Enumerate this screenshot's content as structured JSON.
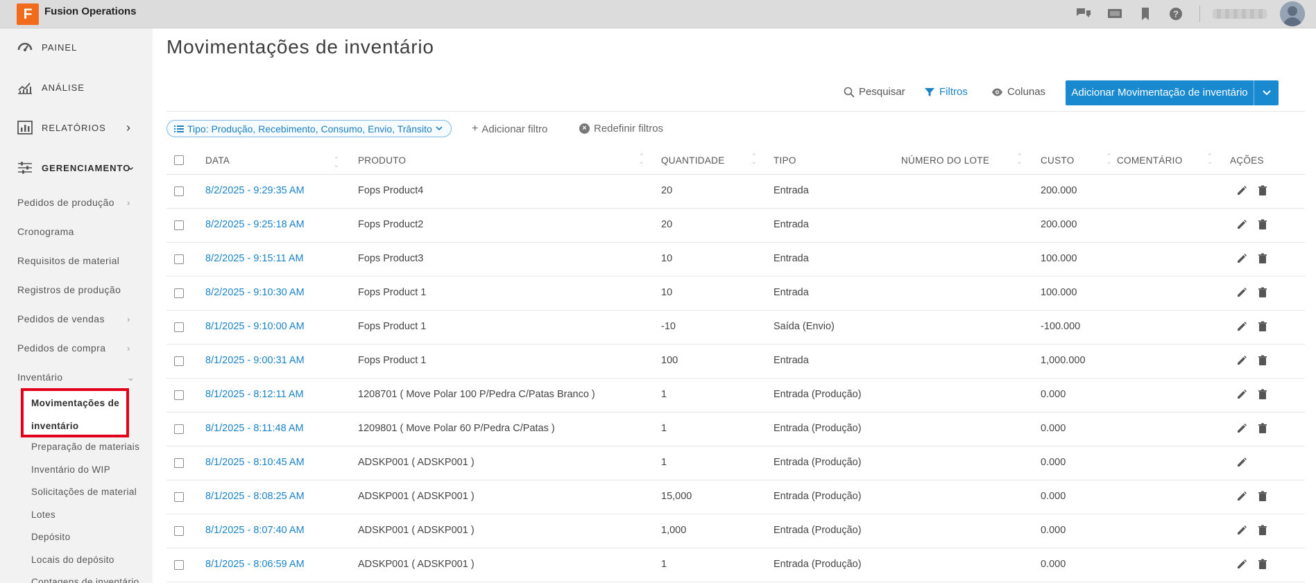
{
  "app": {
    "logo_letter": "F",
    "name": "Fusion Operations"
  },
  "topbar_icons": [
    "chat-icon",
    "monitor-icon",
    "bookmark-icon",
    "help-icon"
  ],
  "sidebar": {
    "main": [
      {
        "label": "PAINEL",
        "icon": "dashboard-gauge-icon"
      },
      {
        "label": "ANÁLISE",
        "icon": "analytics-chart-icon"
      },
      {
        "label": "RELATÓRIOS",
        "icon": "reports-icon",
        "chevron": "›"
      },
      {
        "label": "GERENCIAMENTO",
        "icon": "sliders-icon",
        "chevron": "⌄"
      }
    ],
    "sub": [
      {
        "label": "Pedidos de produção",
        "chevron": "›"
      },
      {
        "label": "Cronograma",
        "chevron": ""
      },
      {
        "label": "Requisitos de material",
        "chevron": ""
      },
      {
        "label": "Registros de produção",
        "chevron": ""
      },
      {
        "label": "Pedidos de vendas",
        "chevron": "›"
      },
      {
        "label": "Pedidos de compra",
        "chevron": "›"
      },
      {
        "label": "Inventário",
        "chevron": "⌄"
      }
    ],
    "active": {
      "line1": "Movimentações de",
      "line2": "inventário"
    },
    "inventory_items": [
      "Preparação de materiais",
      "Inventário do WIP",
      "Solicitações de material",
      "Lotes",
      "Depósito",
      "Locais do depósito",
      "Contagens de inventário"
    ]
  },
  "page": {
    "title": "Movimentações de inventário"
  },
  "toolbar": {
    "search": "Pesquisar",
    "filters": "Filtros",
    "columns": "Colunas",
    "add_button": "Adicionar Movimentação de inventário"
  },
  "filters": {
    "chip": "Tipo: Produção, Recebimento, Consumo, Envio, Trânsito",
    "add": "Adicionar filtro",
    "reset": "Redefinir filtros"
  },
  "table": {
    "headers": {
      "date": "DATA",
      "product": "PRODUTO",
      "quantity": "QUANTIDADE",
      "type": "TIPO",
      "lot": "NÚMERO DO LOTE",
      "cost": "CUSTO",
      "comment": "COMENTÁRIO",
      "actions": "AÇÕES"
    },
    "rows": [
      {
        "date": "8/2/2025 - 9:29:35 AM",
        "product": "Fops Product4",
        "quantity": "20",
        "type": "Entrada",
        "lot": "",
        "cost": "200.000",
        "comment": "",
        "delete": true
      },
      {
        "date": "8/2/2025 - 9:25:18 AM",
        "product": "Fops Product2",
        "quantity": "20",
        "type": "Entrada",
        "lot": "",
        "cost": "200.000",
        "comment": "",
        "delete": true
      },
      {
        "date": "8/2/2025 - 9:15:11 AM",
        "product": "Fops Product3",
        "quantity": "10",
        "type": "Entrada",
        "lot": "",
        "cost": "100.000",
        "comment": "",
        "delete": true
      },
      {
        "date": "8/2/2025 - 9:10:30 AM",
        "product": "Fops Product 1",
        "quantity": "10",
        "type": "Entrada",
        "lot": "",
        "cost": "100.000",
        "comment": "",
        "delete": true
      },
      {
        "date": "8/1/2025 - 9:10:00 AM",
        "product": "Fops Product 1",
        "quantity": "-10",
        "type": "Saída (Envio)",
        "lot": "",
        "cost": "-100.000",
        "comment": "",
        "delete": true
      },
      {
        "date": "8/1/2025 - 9:00:31 AM",
        "product": "Fops Product 1",
        "quantity": "100",
        "type": "Entrada",
        "lot": "",
        "cost": "1,000.000",
        "comment": "",
        "delete": true
      },
      {
        "date": "8/1/2025 - 8:12:11 AM",
        "product": "1208701 ( Move Polar 100 P/Pedra C/Patas Branco )",
        "quantity": "1",
        "type": "Entrada (Produção)",
        "lot": "",
        "cost": "0.000",
        "comment": "",
        "delete": true
      },
      {
        "date": "8/1/2025 - 8:11:48 AM",
        "product": "1209801 ( Move Polar 60 P/Pedra C/Patas )",
        "quantity": "1",
        "type": "Entrada (Produção)",
        "lot": "",
        "cost": "0.000",
        "comment": "",
        "delete": true
      },
      {
        "date": "8/1/2025 - 8:10:45 AM",
        "product": "ADSKP001 ( ADSKP001 )",
        "quantity": "1",
        "type": "Entrada (Produção)",
        "lot": "",
        "cost": "0.000",
        "comment": "",
        "delete": false
      },
      {
        "date": "8/1/2025 - 8:08:25 AM",
        "product": "ADSKP001 ( ADSKP001 )",
        "quantity": "15,000",
        "type": "Entrada (Produção)",
        "lot": "",
        "cost": "0.000",
        "comment": "",
        "delete": true
      },
      {
        "date": "8/1/2025 - 8:07:40 AM",
        "product": "ADSKP001 ( ADSKP001 )",
        "quantity": "1,000",
        "type": "Entrada (Produção)",
        "lot": "",
        "cost": "0.000",
        "comment": "",
        "delete": true
      },
      {
        "date": "8/1/2025 - 8:06:59 AM",
        "product": "ADSKP001 ( ADSKP001 )",
        "quantity": "1",
        "type": "Entrada (Produção)",
        "lot": "",
        "cost": "0.000",
        "comment": "",
        "delete": true
      }
    ]
  },
  "colors": {
    "accent": "#1a8ad0",
    "link": "#1a83c6",
    "brand": "#f26b1d",
    "highlight": "#e3001b"
  }
}
